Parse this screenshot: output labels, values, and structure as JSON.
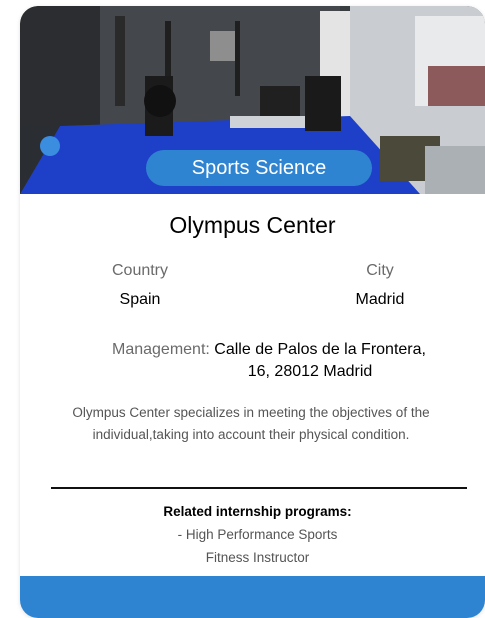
{
  "card": {
    "category": "Sports Science",
    "title": "Olympus Center",
    "country_label": "Country",
    "country_value": "Spain",
    "city_label": "City",
    "city_value": "Madrid",
    "management_label": "Management:",
    "management_line1": "Calle de Palos de la Frontera,",
    "management_line2": "16, 28012 Madrid",
    "description_line1": "Olympus Center specializes in meeting the objectives of the",
    "description_line2": "individual,taking into account their physical condition.",
    "related_title": "Related internship programs:",
    "related_programs": [
      "- High Performance Sports",
      "Fitness Instructor"
    ]
  },
  "colors": {
    "accent": "#2f84d1",
    "label_gray": "#6a6a6a",
    "text_gray": "#555555"
  }
}
